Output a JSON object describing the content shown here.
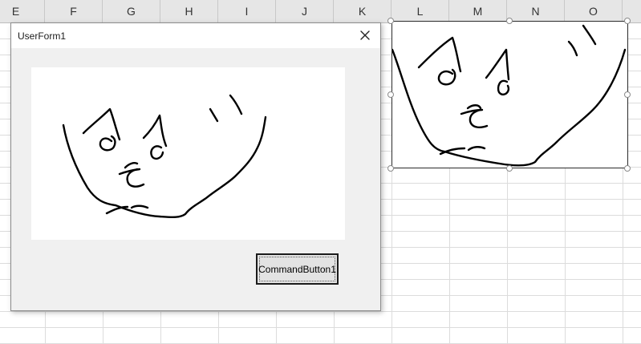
{
  "sheet": {
    "columns": [
      "E",
      "F",
      "G",
      "H",
      "I",
      "J",
      "K",
      "L",
      "M",
      "N",
      "O"
    ]
  },
  "userform": {
    "title": "UserForm1",
    "button_label": "CommandButton1"
  },
  "icons": {
    "close": "close-icon"
  }
}
